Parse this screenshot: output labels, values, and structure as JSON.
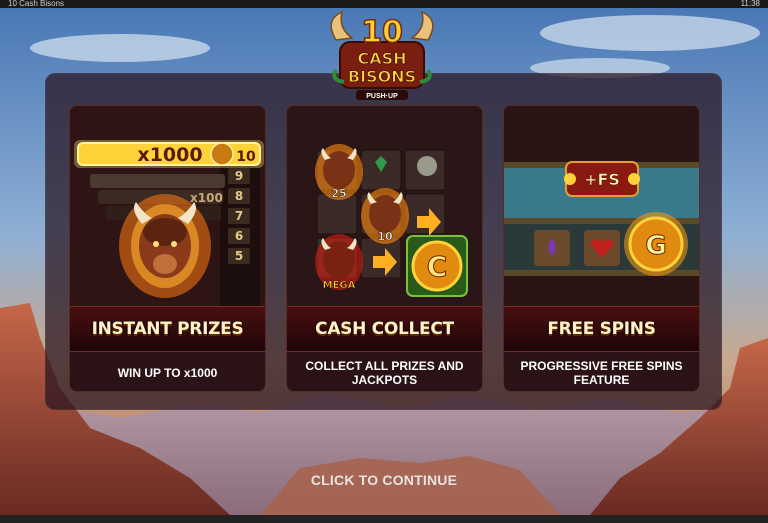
{
  "window": {
    "title": "10 Cash Bisons",
    "clock": "11:38"
  },
  "logo": {
    "number": "10",
    "title_line1": "CASH",
    "title_line2": "BISONS",
    "tagline": "PUSH·UP"
  },
  "cards": [
    {
      "title": "INSTANT PRIZES",
      "description": "WIN UP TO x1000",
      "art": {
        "multiplier_text": "x1000",
        "badge_value": "10",
        "scale_values": [
          "x100",
          "8",
          "7",
          "6",
          "5",
          "9"
        ]
      }
    },
    {
      "title": "CASH COLLECT",
      "description": "COLLECT ALL PRIZES AND JACKPOTS",
      "art": {
        "bison_values": [
          "25",
          "10"
        ],
        "mega_label": "MEGA",
        "collect_symbol": "C"
      }
    },
    {
      "title": "FREE SPINS",
      "description": "PROGRESSIVE FREE SPINS FEATURE",
      "art": {
        "fs_label": "+FS",
        "feature_symbol": "G"
      }
    }
  ],
  "footer": {
    "continue_label": "CLICK TO CONTINUE"
  },
  "colors": {
    "title_text": "#fff1c8",
    "gold": "#ffb21e",
    "panel": "#2a1216",
    "accent_red": "#5a0e10"
  }
}
